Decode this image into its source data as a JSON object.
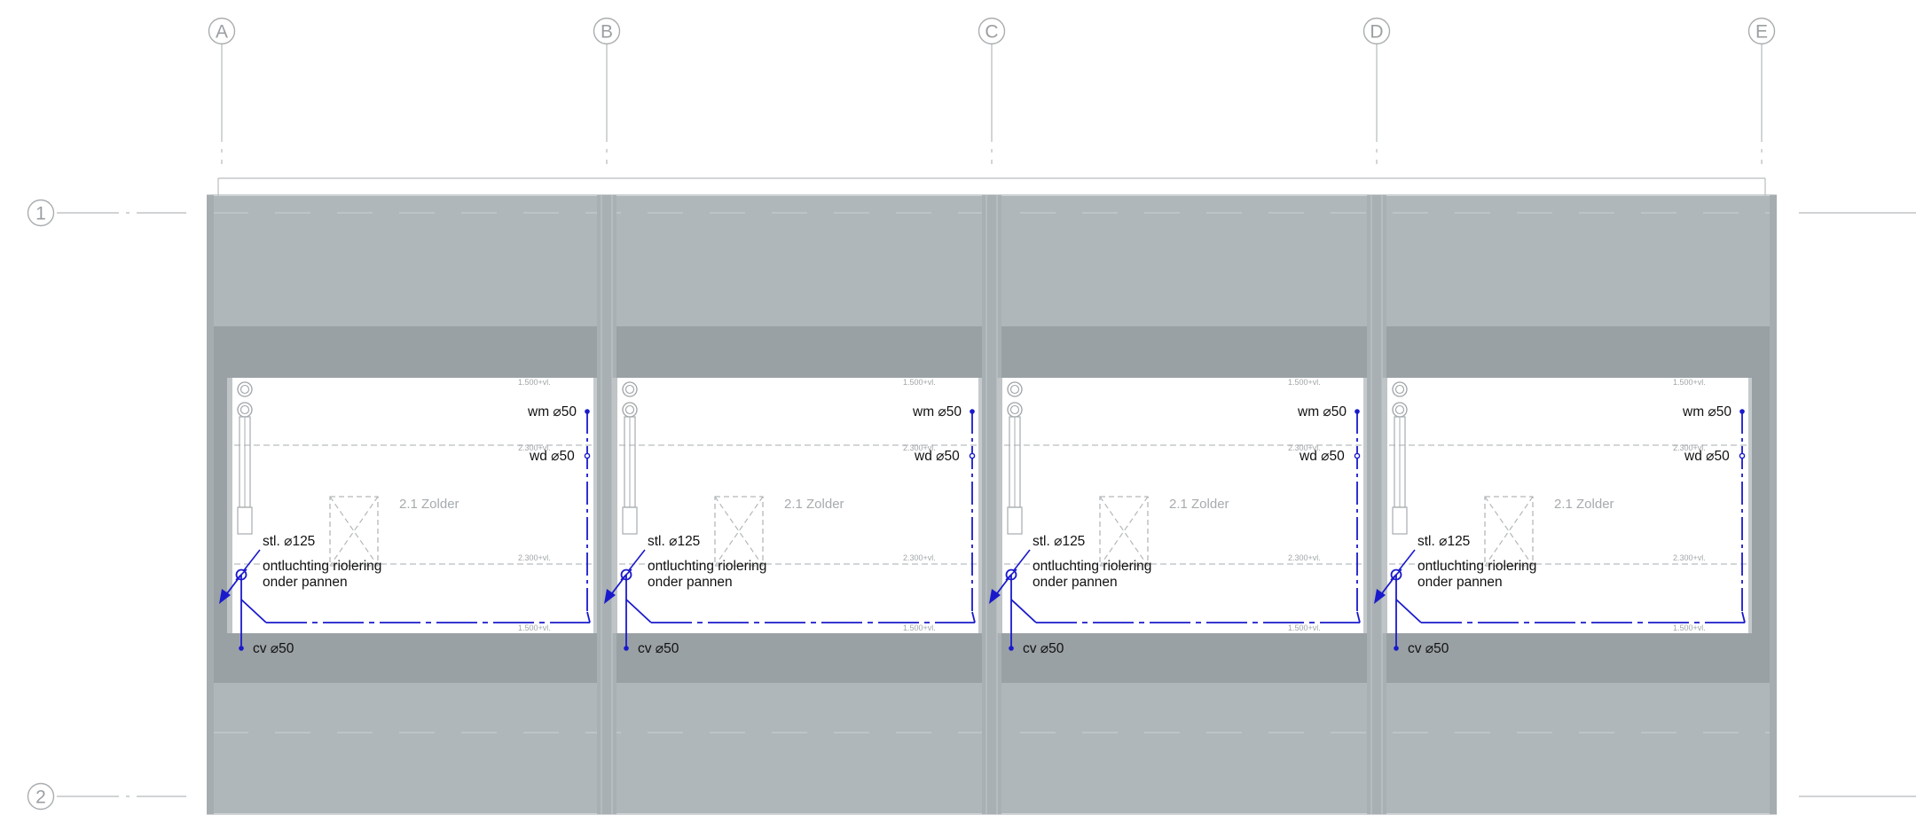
{
  "grid": {
    "columns": [
      "A",
      "B",
      "C",
      "D",
      "E"
    ],
    "rows": [
      "1",
      "2"
    ]
  },
  "units": [
    {
      "room_label": "2.1 Zolder",
      "level_top": "1.500+vl.",
      "level_mid": "2.300+vl.",
      "level_ghost": "2.300+vl.",
      "level_bottom": "1.500+vl.",
      "pipes": {
        "washing_machine": "wm ⌀50",
        "dryer": "wd ⌀50",
        "stack": "stl. ⌀125",
        "vent_line1": "ontluchting riolering",
        "vent_line2": "onder pannen",
        "heating": "cv ⌀50"
      }
    },
    {
      "room_label": "2.1 Zolder",
      "level_top": "1.500+vl.",
      "level_mid": "2.300+vl.",
      "level_ghost": "2.300+vl.",
      "level_bottom": "1.500+vl.",
      "pipes": {
        "washing_machine": "wm ⌀50",
        "dryer": "wd ⌀50",
        "stack": "stl. ⌀125",
        "vent_line1": "ontluchting riolering",
        "vent_line2": "onder pannen",
        "heating": "cv ⌀50"
      }
    },
    {
      "room_label": "2.1 Zolder",
      "level_top": "1.500+vl.",
      "level_mid": "2.300+vl.",
      "level_ghost": "2.300+vl.",
      "level_bottom": "1.500+vl.",
      "pipes": {
        "washing_machine": "wm ⌀50",
        "dryer": "wd ⌀50",
        "stack": "stl. ⌀125",
        "vent_line1": "ontluchting riolering",
        "vent_line2": "onder pannen",
        "heating": "cv ⌀50"
      }
    },
    {
      "room_label": "2.1 Zolder",
      "level_top": "1.500+vl.",
      "level_mid": "2.300+vl.",
      "level_ghost": "2.300+vl.",
      "level_bottom": "1.500+vl.",
      "pipes": {
        "washing_machine": "wm ⌀50",
        "dryer": "wd ⌀50",
        "stack": "stl. ⌀125",
        "vent_line1": "ontluchting riolering",
        "vent_line2": "onder pannen",
        "heating": "cv ⌀50"
      }
    }
  ],
  "colors": {
    "roof_light": "#b0b7ba",
    "roof_dark": "#9aa1a4",
    "pipe_blue": "#1a1acc",
    "grid_line": "#b5b9bc",
    "room_fill": "#ffffff"
  }
}
